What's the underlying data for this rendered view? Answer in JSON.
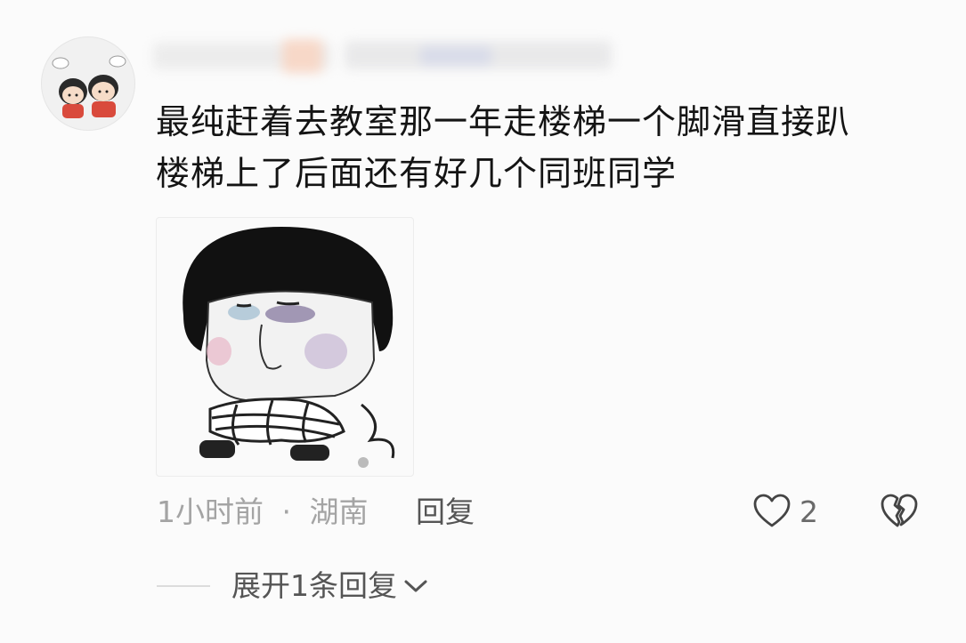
{
  "comment": {
    "text_line1": "最纯赶着去教室那一年走楼梯一个脚滑直接趴",
    "text_line2": "楼梯上了后面还有好几个同班同学",
    "time": "1小时前",
    "separator": "·",
    "location": "湖南",
    "reply_label": "回复",
    "like_count": "2",
    "expand_label": "展开1条回复"
  },
  "icons": {
    "like": "heart-outline-icon",
    "dislike": "broken-heart-icon",
    "expand": "chevron-down-icon"
  },
  "colors": {
    "text_primary": "#141414",
    "text_meta": "#a4a4a4",
    "text_secondary": "#555555"
  }
}
